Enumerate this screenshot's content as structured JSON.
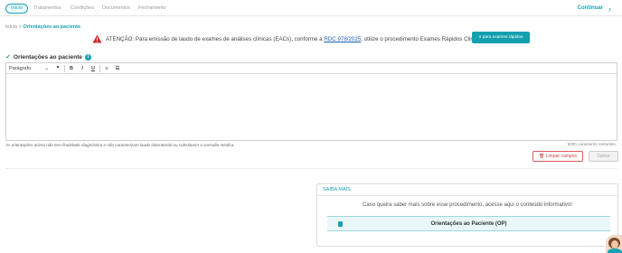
{
  "tabs": [
    {
      "label": "Início",
      "active": true
    },
    {
      "label": "Tratamentos",
      "active": false
    },
    {
      "label": "Condições",
      "active": false
    },
    {
      "label": "Documentos",
      "active": false
    },
    {
      "label": "Fechamento",
      "active": false
    }
  ],
  "continue_label": "Continuar",
  "breadcrumb": {
    "root": "Início",
    "separator": ">",
    "current": "Orientações ao paciente"
  },
  "alert": {
    "text_before": "ATENÇÃO: Para emissão de laudo de exames de análises clínicas (EACs), conforme a",
    "link": "RDC 978/2025",
    "text_after": ", utilize o procedimento Exames Rápidos Clinicarx!",
    "button_label": "Ir para exames rápidos"
  },
  "section": {
    "title": "Orientações ao paciente",
    "info_icon": "i"
  },
  "editor": {
    "paragraph_label": "Parágrafo",
    "toolbar": [
      "❝",
      "B",
      "I",
      "U",
      "≡",
      "☰"
    ],
    "content": ""
  },
  "disclaimer": "As orientações acima não tem finalidade diagnóstica e não caracterizam laudo laboratorial ou substituem a consulta médica.",
  "char_counter": "5000 caracteres restantes.",
  "buttons": {
    "clear": "Limpar campos",
    "save": "Salvar"
  },
  "info_card": {
    "header": "SAIBA MAIS",
    "text": "Caso queira saber mais sobre esse procedimento, acesse aqui o conteúdo informativo!",
    "link_label": "Orientações ao Paciente (OP)"
  },
  "colors": {
    "accent": "#16a3b1",
    "danger": "#d14545",
    "warning": "#d62828"
  }
}
